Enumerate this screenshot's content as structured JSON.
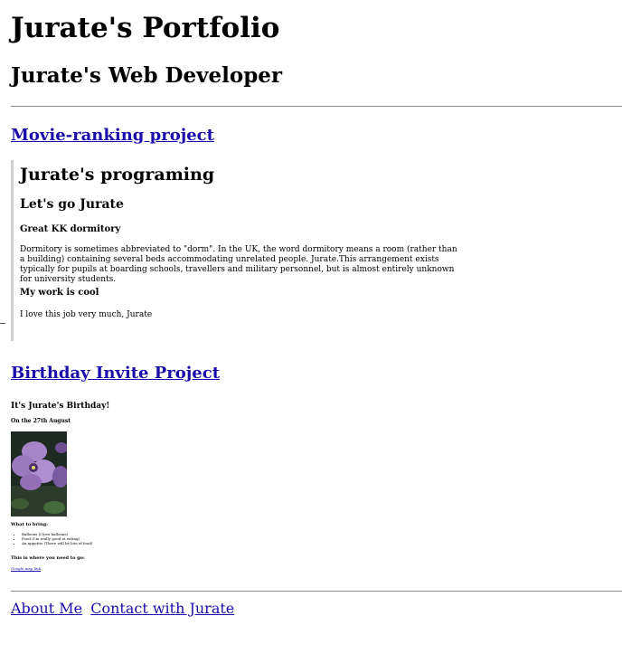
{
  "header": {
    "title": "Jurate's Portfolio",
    "subtitle": "Jurate's Web Developer"
  },
  "projects": {
    "movie": {
      "link": "Movie-ranking project",
      "embed": {
        "heading": "Jurate's programing",
        "subheading": "Let's go Jurate",
        "section1_title": "Great KK dormitory",
        "section1_text": "Dormitory is sometimes abbreviated to \"dorm\". In the UK, the word dormitory means a room (rather than a building) containing several beds accommodating unrelated people. Jurate.This arrangement exists typically for pupils at boarding schools, travellers and military personnel, but is almost entirely unknown for university students.",
        "section2_title": "My work is cool",
        "section2_text": "I love this job very much, Jurate"
      }
    },
    "birthday": {
      "link": "Birthday Invite Project",
      "embed": {
        "heading": "It's Jurate's Birthday!",
        "date": "On the 27th August",
        "bring_title": "What to bring:",
        "bring_items": [
          "Balloons (I love balloons)",
          "Food (I'm really good at eating)",
          "An appetite (There will be lots of food)"
        ],
        "where_title": "This is where you need to go:",
        "map_link": "Google map link"
      }
    }
  },
  "footer": {
    "about": "About Me",
    "contact": "Contact with Jurate"
  },
  "colors": {
    "link": "#1a0dab",
    "rule": "#8a8a8a",
    "quote_border": "#cfcfcf"
  }
}
